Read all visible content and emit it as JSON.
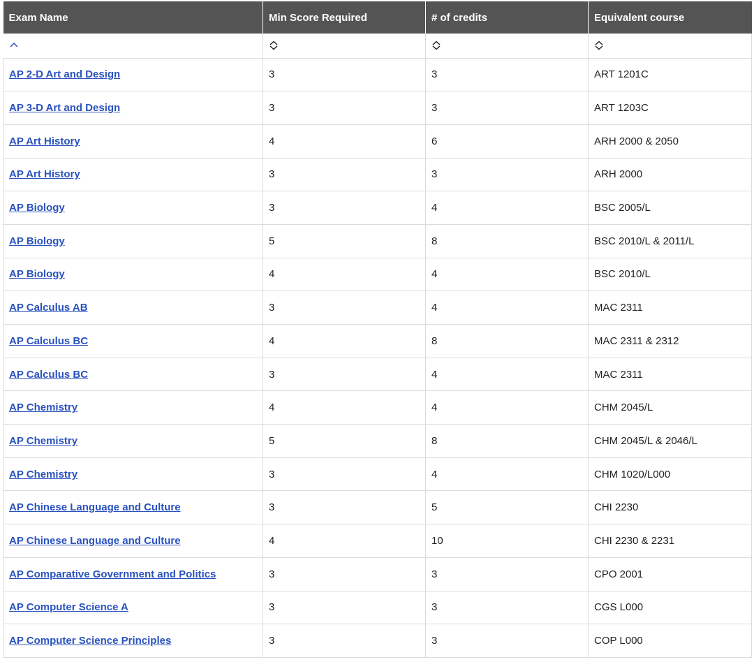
{
  "columns": [
    {
      "label": "Exam Name",
      "sort_icon": "chevron-up-icon"
    },
    {
      "label": "Min Score Required",
      "sort_icon": "sort-both-icon"
    },
    {
      "label": "# of credits",
      "sort_icon": "sort-both-icon"
    },
    {
      "label": "Equivalent course",
      "sort_icon": "sort-both-icon"
    }
  ],
  "colors": {
    "header_bg": "#545454",
    "link": "#2a52be",
    "border": "#dcdcdc"
  },
  "rows": [
    {
      "exam": "AP 2-D Art and Design",
      "score": "3",
      "credits": "3",
      "course": "ART 1201C"
    },
    {
      "exam": "AP 3-D Art and Design",
      "score": "3",
      "credits": "3",
      "course": "ART 1203C"
    },
    {
      "exam": "AP Art History",
      "score": "4",
      "credits": "6",
      "course": "ARH 2000 & 2050"
    },
    {
      "exam": "AP Art History",
      "score": "3",
      "credits": "3",
      "course": "ARH 2000"
    },
    {
      "exam": "AP Biology",
      "score": "3",
      "credits": "4",
      "course": "BSC 2005/L"
    },
    {
      "exam": "AP Biology",
      "score": "5",
      "credits": "8",
      "course": "BSC 2010/L & 2011/L"
    },
    {
      "exam": "AP Biology",
      "score": "4",
      "credits": "4",
      "course": "BSC 2010/L"
    },
    {
      "exam": "AP Calculus AB",
      "score": "3",
      "credits": "4",
      "course": "MAC 2311"
    },
    {
      "exam": "AP Calculus BC",
      "score": "4",
      "credits": "8",
      "course": "MAC 2311 & 2312"
    },
    {
      "exam": "AP Calculus BC",
      "score": "3",
      "credits": "4",
      "course": "MAC 2311"
    },
    {
      "exam": "AP Chemistry",
      "score": "4",
      "credits": "4",
      "course": "CHM 2045/L"
    },
    {
      "exam": "AP Chemistry",
      "score": "5",
      "credits": "8",
      "course": "CHM 2045/L & 2046/L"
    },
    {
      "exam": "AP Chemistry",
      "score": "3",
      "credits": "4",
      "course": "CHM 1020/L000"
    },
    {
      "exam": "AP Chinese Language and Culture",
      "score": "3",
      "credits": "5",
      "course": "CHI 2230"
    },
    {
      "exam": "AP Chinese Language and Culture",
      "score": "4",
      "credits": "10",
      "course": "CHI 2230 & 2231"
    },
    {
      "exam": "AP Comparative Government and Politics",
      "score": "3",
      "credits": "3",
      "course": "CPO 2001"
    },
    {
      "exam": "AP Computer Science A",
      "score": "3",
      "credits": "3",
      "course": "CGS L000"
    },
    {
      "exam": "AP Computer Science Principles",
      "score": "3",
      "credits": "3",
      "course": "COP L000"
    }
  ]
}
